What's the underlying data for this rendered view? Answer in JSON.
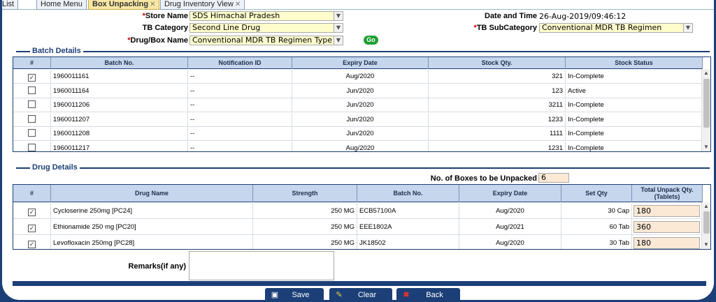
{
  "tabs": [
    {
      "label": "List",
      "active": false,
      "closable": false
    },
    {
      "label": "Home Menu",
      "active": false,
      "closable": false
    },
    {
      "label": "Box Unpacking",
      "active": true,
      "closable": true
    },
    {
      "label": "Drug Inventory View",
      "active": false,
      "closable": true
    }
  ],
  "form": {
    "store_name_label": "Store Name",
    "store_name_value": "SDS Himachal Pradesh",
    "tb_category_label": "TB Category",
    "tb_category_value": "Second Line Drug",
    "drug_box_label": "Drug/Box Name",
    "drug_box_value": "Conventional MDR TB Regimen Type A",
    "go_label": "Go",
    "date_time_label": "Date and Time",
    "date_time_value": "26-Aug-2019/09:46:12",
    "tb_subcategory_label": "TB SubCategory",
    "tb_subcategory_value": "Conventional MDR TB Regimen"
  },
  "batch": {
    "title": "Batch Details",
    "headers": [
      "#",
      "Batch No.",
      "Notification ID",
      "Expiry Date",
      "Stock Qty.",
      "Stock Status"
    ],
    "rows": [
      {
        "checked": true,
        "batch_no": "1960011161",
        "notification_id": "--",
        "expiry": "Aug/2020",
        "qty": "321",
        "status": "In-Complete"
      },
      {
        "checked": false,
        "batch_no": "1960011164",
        "notification_id": "--",
        "expiry": "Jun/2020",
        "qty": "123",
        "status": "Active"
      },
      {
        "checked": false,
        "batch_no": "1960011206",
        "notification_id": "--",
        "expiry": "Jun/2020",
        "qty": "3211",
        "status": "In-Complete"
      },
      {
        "checked": false,
        "batch_no": "1960011207",
        "notification_id": "--",
        "expiry": "Jun/2020",
        "qty": "1233",
        "status": "In-Complete"
      },
      {
        "checked": false,
        "batch_no": "1960011208",
        "notification_id": "--",
        "expiry": "Jun/2020",
        "qty": "1111",
        "status": "In-Complete"
      },
      {
        "checked": false,
        "batch_no": "1960011217",
        "notification_id": "--",
        "expiry": "Aug/2020",
        "qty": "1231",
        "status": "In-Complete"
      }
    ]
  },
  "drug": {
    "title": "Drug Details",
    "boxes_label": "No. of Boxes to be Unpacked",
    "boxes_value": "6",
    "headers": [
      "#",
      "Drug Name",
      "Strength",
      "Batch No.",
      "Expiry Date",
      "Set Qty",
      "Total Unpack Qty.(Tablets)"
    ],
    "rows": [
      {
        "checked": true,
        "name": "Cycloserine 250mg [PC24]",
        "strength": "250 MG",
        "batch": "ECB57100A",
        "expiry": "Aug/2020",
        "set_qty": "30 Cap",
        "total": "180"
      },
      {
        "checked": true,
        "name": "Ethionamide 250 mg [PC20]",
        "strength": "250 MG",
        "batch": "EEE1802A",
        "expiry": "Aug/2021",
        "set_qty": "60 Tab",
        "total": "360"
      },
      {
        "checked": true,
        "name": "Levofloxacin 250mg [PC28]",
        "strength": "250 MG",
        "batch": "JK18502",
        "expiry": "Aug/2020",
        "set_qty": "30 Tab",
        "total": "180"
      }
    ]
  },
  "remarks_label": "Remarks(if any)",
  "buttons": {
    "save": "Save",
    "clear": "Clear",
    "back": "Back"
  }
}
